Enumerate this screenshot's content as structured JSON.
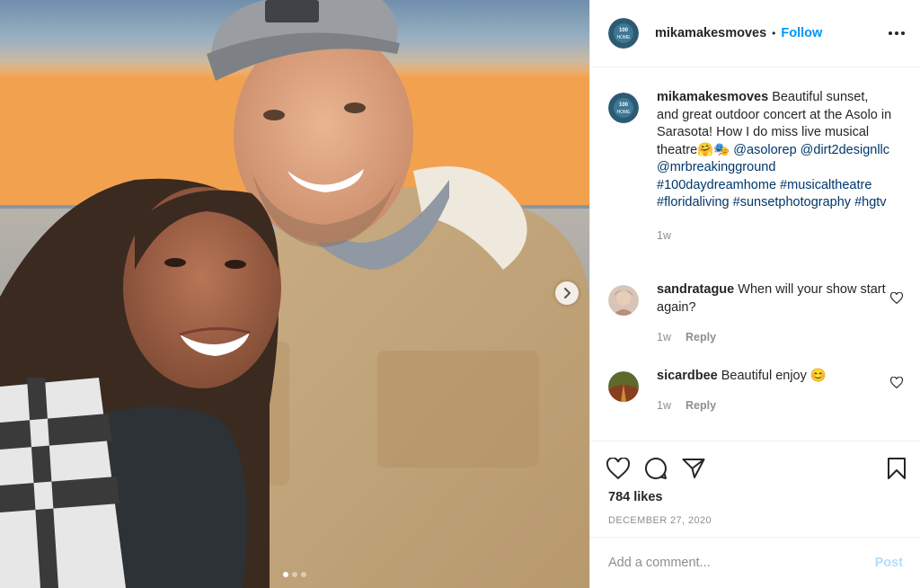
{
  "header": {
    "username": "mikamakesmoves",
    "separator": "•",
    "follow_label": "Follow",
    "avatar_text": "100 DAY HOME"
  },
  "caption": {
    "username": "mikamakesmoves",
    "text": "Beautiful sunset, and great outdoor concert at the Asolo in Sarasota! How I do miss live musical theatre🤗🎭",
    "tags": [
      "@asolorep",
      "@dirt2designllc",
      "@mrbreakingground",
      "#100daydreamhome",
      "#musicaltheatre",
      "#floridaliving",
      "#sunsetphotography",
      "#hgtv"
    ],
    "time": "1w"
  },
  "comments": [
    {
      "username": "sandratague",
      "text": "When will your show start again?",
      "time": "1w",
      "reply_label": "Reply"
    },
    {
      "username": "sicardbee",
      "text": "Beautiful enjoy 😊",
      "time": "1w",
      "reply_label": "Reply"
    }
  ],
  "likes": "784 likes",
  "date": "DECEMBER 27, 2020",
  "add_comment": {
    "placeholder": "Add a comment...",
    "post_label": "Post"
  },
  "carousel": {
    "slide_count": 3,
    "active_index": 0
  },
  "colors": {
    "link": "#00376b",
    "follow": "#0095f6",
    "post_disabled": "#b2dffc",
    "muted": "#8e8e8e"
  }
}
